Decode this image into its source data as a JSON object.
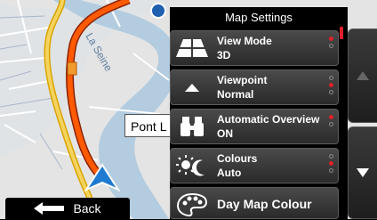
{
  "map": {
    "river_label": "La Seine",
    "place_label": "Pont L",
    "colors": {
      "land": "#e4e4e4",
      "water": "#b3ccdf",
      "route": "#ff5a00",
      "highway": "#f4c438",
      "arrow": "#1f7bd1"
    }
  },
  "back": {
    "label": "Back",
    "icon": "arrow-left-icon"
  },
  "panel": {
    "title": "Map Settings",
    "items": [
      {
        "label": "View Mode",
        "value": "3D",
        "icon": "view-mode-icon",
        "options": [
          true,
          false
        ]
      },
      {
        "label": "Viewpoint",
        "value": "Normal",
        "icon": "viewpoint-icon",
        "options": [
          false,
          true,
          false
        ]
      },
      {
        "label": "Automatic Overview",
        "value": "ON",
        "icon": "binoculars-icon",
        "options": [
          true,
          false
        ]
      },
      {
        "label": "Colours",
        "value": "Auto",
        "icon": "sun-moon-icon",
        "options": [
          false,
          true,
          false
        ]
      }
    ],
    "day_colour": {
      "label": "Day Map Colour",
      "icon": "palette-icon"
    }
  },
  "scroll": {
    "up_icon": "arrow-up-icon",
    "down_icon": "arrow-down-icon"
  }
}
